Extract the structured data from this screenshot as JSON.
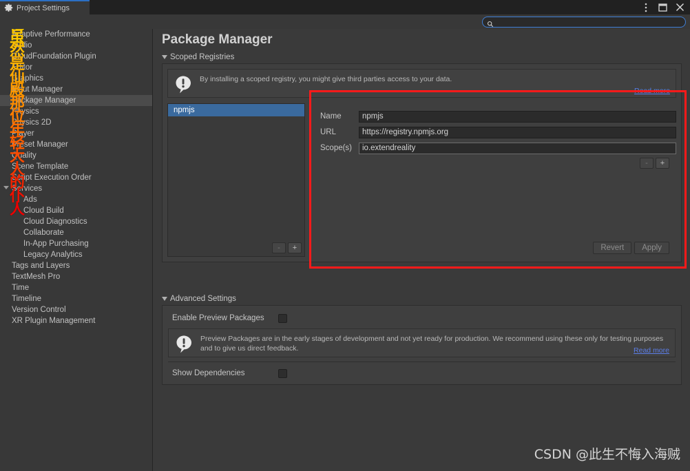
{
  "window": {
    "tab_label": "Project Settings",
    "tab_icon": "gear-icon",
    "controls": [
      "more-options-icon",
      "maximize-icon",
      "close-icon"
    ]
  },
  "search": {
    "value": "",
    "placeholder": "",
    "icon": "search-icon"
  },
  "sidebar": {
    "items": [
      {
        "label": "Adaptive Performance",
        "level": 0,
        "expandable": false,
        "selected": false
      },
      {
        "label": "Audio",
        "level": 0,
        "expandable": false,
        "selected": false
      },
      {
        "label": "CloudFoundation Plugin",
        "level": 0,
        "expandable": false,
        "selected": false
      },
      {
        "label": "Editor",
        "level": 0,
        "expandable": false,
        "selected": false
      },
      {
        "label": "Graphics",
        "level": 0,
        "expandable": false,
        "selected": false
      },
      {
        "label": "Input Manager",
        "level": 0,
        "expandable": false,
        "selected": false
      },
      {
        "label": "Package Manager",
        "level": 0,
        "expandable": false,
        "selected": true
      },
      {
        "label": "Physics",
        "level": 0,
        "expandable": false,
        "selected": false
      },
      {
        "label": "Physics 2D",
        "level": 0,
        "expandable": false,
        "selected": false
      },
      {
        "label": "Player",
        "level": 0,
        "expandable": false,
        "selected": false
      },
      {
        "label": "Preset Manager",
        "level": 0,
        "expandable": false,
        "selected": false
      },
      {
        "label": "Quality",
        "level": 0,
        "expandable": false,
        "selected": false
      },
      {
        "label": "Scene Template",
        "level": 0,
        "expandable": false,
        "selected": false
      },
      {
        "label": "Script Execution Order",
        "level": 0,
        "expandable": false,
        "selected": false
      },
      {
        "label": "Services",
        "level": 0,
        "expandable": true,
        "selected": false
      },
      {
        "label": "Ads",
        "level": 1,
        "expandable": false,
        "selected": false
      },
      {
        "label": "Cloud Build",
        "level": 1,
        "expandable": false,
        "selected": false
      },
      {
        "label": "Cloud Diagnostics",
        "level": 1,
        "expandable": false,
        "selected": false
      },
      {
        "label": "Collaborate",
        "level": 1,
        "expandable": false,
        "selected": false
      },
      {
        "label": "In-App Purchasing",
        "level": 1,
        "expandable": false,
        "selected": false
      },
      {
        "label": "Legacy Analytics",
        "level": 1,
        "expandable": false,
        "selected": false
      },
      {
        "label": "Tags and Layers",
        "level": 0,
        "expandable": false,
        "selected": false
      },
      {
        "label": "TextMesh Pro",
        "level": 0,
        "expandable": false,
        "selected": false
      },
      {
        "label": "Time",
        "level": 0,
        "expandable": false,
        "selected": false
      },
      {
        "label": "Timeline",
        "level": 0,
        "expandable": false,
        "selected": false
      },
      {
        "label": "Version Control",
        "level": 0,
        "expandable": false,
        "selected": false
      },
      {
        "label": "XR Plugin Management",
        "level": 0,
        "expandable": false,
        "selected": false
      }
    ]
  },
  "overlay_watermark": {
    "characters": [
      "他",
      "虽",
      "然",
      "是",
      "仙",
      "殿",
      "那",
      "位",
      "年",
      "轻",
      "大",
      "人",
      "的",
      "仆",
      "人"
    ],
    "colors": [
      "#ffd400",
      "#ffc900",
      "#ffbe00",
      "#ffb300",
      "#ffa600",
      "#ff9a00",
      "#ff8d00",
      "#ff7e00",
      "#ff6f00",
      "#ff5e00",
      "#fb4b00",
      "#f63800",
      "#f22400",
      "#ef1100",
      "#ed0000"
    ]
  },
  "main": {
    "title": "Package Manager",
    "scoped_registries": {
      "header": "Scoped Registries",
      "help": {
        "icon": "info-icon",
        "text": "By installing a scoped registry, you might give third parties access to your data.",
        "link": "Read more"
      },
      "list": {
        "items": [
          {
            "label": "npmjs",
            "selected": true
          }
        ],
        "remove_button": "-",
        "add_button": "+"
      },
      "detail": {
        "fields": [
          {
            "label": "Name",
            "value": "npmjs"
          },
          {
            "label": "URL",
            "value": "https://registry.npmjs.org"
          },
          {
            "label": "Scope(s)",
            "value": "io.extendreality"
          }
        ],
        "remove_scope_button": "-",
        "add_scope_button": "+",
        "revert_button": "Revert",
        "apply_button": "Apply"
      }
    },
    "advanced_settings": {
      "header": "Advanced Settings",
      "enable_preview_label": "Enable Preview Packages",
      "enable_preview_checked": false,
      "help": {
        "icon": "info-icon",
        "text": "Preview Packages are in the early stages of development and not yet ready for production. We recommend using these only for testing purposes and to give us direct feedback.",
        "link": "Read more"
      },
      "show_dependencies_label": "Show Dependencies",
      "show_dependencies_checked": false
    }
  },
  "annotation": {
    "color": "#ff1a1a",
    "shape": "rectangle"
  },
  "page_watermark": {
    "text": "CSDN @此生不悔入海贼"
  }
}
